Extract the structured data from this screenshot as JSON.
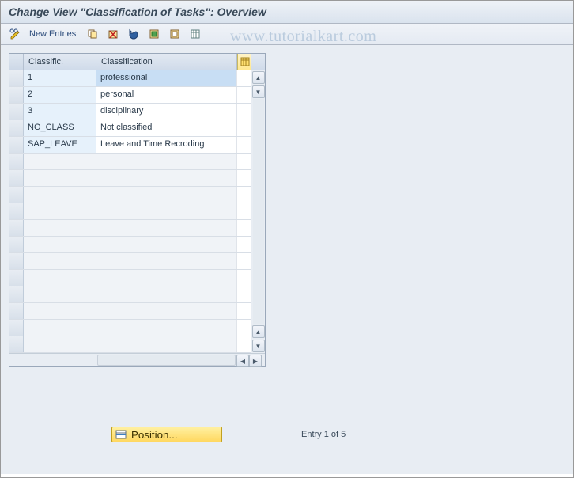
{
  "title": "Change View \"Classification of Tasks\": Overview",
  "toolbar": {
    "new_entries_label": "New Entries"
  },
  "table": {
    "headers": {
      "classific": "Classific.",
      "classification": "Classification"
    },
    "rows": [
      {
        "key": "1",
        "value": "professional",
        "selected": true
      },
      {
        "key": "2",
        "value": "personal",
        "selected": false
      },
      {
        "key": "3",
        "value": "disciplinary",
        "selected": false
      },
      {
        "key": "NO_CLASS",
        "value": "Not classified",
        "selected": false
      },
      {
        "key": "SAP_LEAVE",
        "value": "Leave and Time Recroding",
        "selected": false
      }
    ],
    "empty_row_count": 12
  },
  "footer": {
    "position_label": "Position...",
    "entry_status": "Entry 1 of 5"
  },
  "watermark": "www.tutorialkart.com"
}
